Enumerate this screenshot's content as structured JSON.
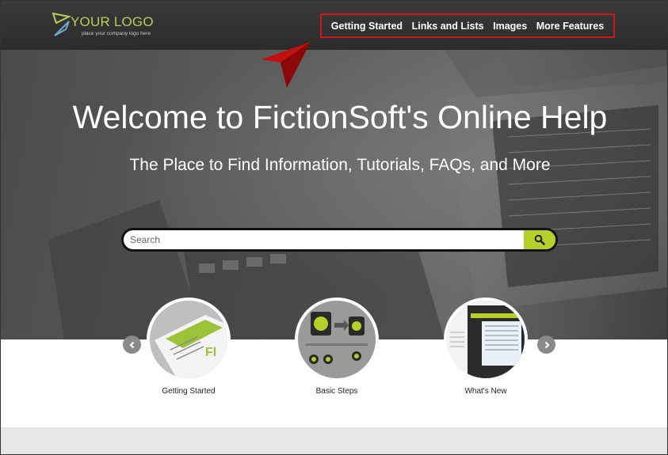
{
  "logo": {
    "title": "YOUR LOGO",
    "tagline": "place your company logo here",
    "color": "#b9ce57"
  },
  "nav": {
    "items": [
      {
        "label": "Getting Started"
      },
      {
        "label": "Links and Lists"
      },
      {
        "label": "Images"
      },
      {
        "label": "More Features"
      }
    ],
    "highlight_color": "#d01818"
  },
  "hero": {
    "title": "Welcome to FictionSoft's Online Help",
    "subtitle": "The Place to Find Information, Tutorials, FAQs, and More"
  },
  "search": {
    "placeholder": "Search",
    "button_icon": "search-icon",
    "accent_color": "#b7cf2b"
  },
  "carousel": {
    "prev_icon": "chevron-left-icon",
    "next_icon": "chevron-right-icon",
    "cards": [
      {
        "label": "Getting Started"
      },
      {
        "label": "Basic Steps"
      },
      {
        "label": "What's New"
      }
    ]
  },
  "annotation": {
    "icon": "red-arrow-pointer-icon",
    "color": "#cc1111"
  }
}
